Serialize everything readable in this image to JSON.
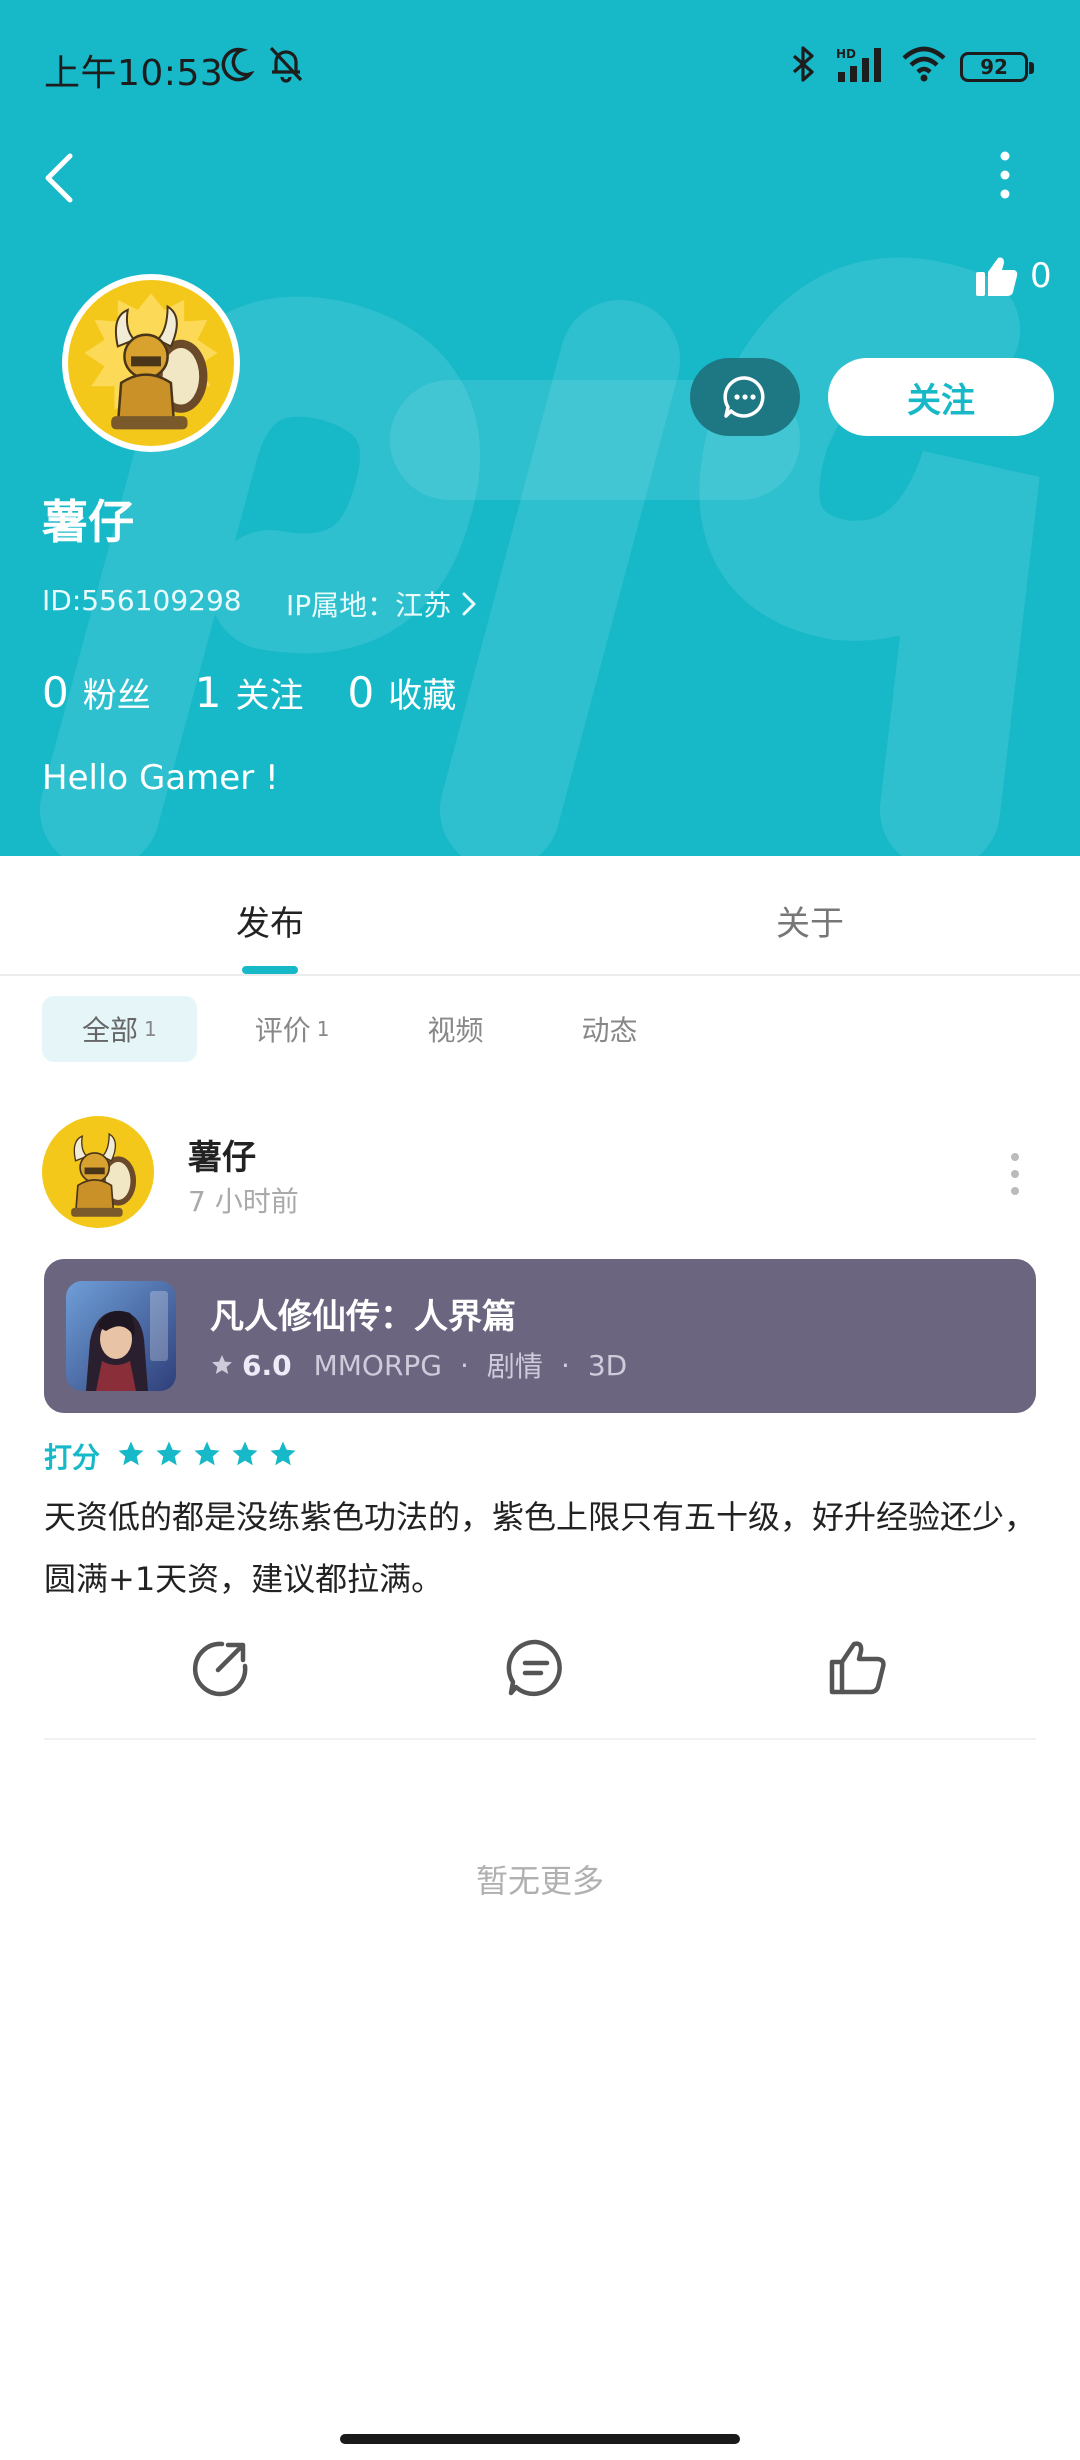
{
  "status_bar": {
    "time": "上午10:53",
    "battery": "92"
  },
  "profile": {
    "likes": "0",
    "follow_label": "关注",
    "name": "薯仔",
    "id_text": "ID:556109298",
    "ip_text": "IP属地：江苏",
    "stats": [
      {
        "num": "0",
        "label": "粉丝"
      },
      {
        "num": "1",
        "label": "关注"
      },
      {
        "num": "0",
        "label": "收藏"
      }
    ],
    "bio": "Hello Gamer !"
  },
  "tabs": {
    "post": "发布",
    "about": "关于"
  },
  "filters": [
    {
      "label": "全部",
      "count": "1"
    },
    {
      "label": "评价",
      "count": "1"
    },
    {
      "label": "视频",
      "count": ""
    },
    {
      "label": "动态",
      "count": ""
    }
  ],
  "post": {
    "user": "薯仔",
    "time": "7 小时前",
    "game": {
      "title": "凡人修仙传：人界篇",
      "score": "6.0",
      "tags": [
        "MMORPG",
        "剧情",
        "3D"
      ]
    },
    "rating_label": "打分",
    "rating": 5,
    "review": "天资低的都是没练紫色功法的，紫色上限只有五十级，好升经验还少，圆满+1天资，建议都拉满。"
  },
  "footer_text": "暂无更多",
  "colors": {
    "accent": "#17b9c9",
    "header_bg": "#17b9c9",
    "game_card_bg": "#6b6580",
    "chat_btn_bg": "#1d7884"
  }
}
